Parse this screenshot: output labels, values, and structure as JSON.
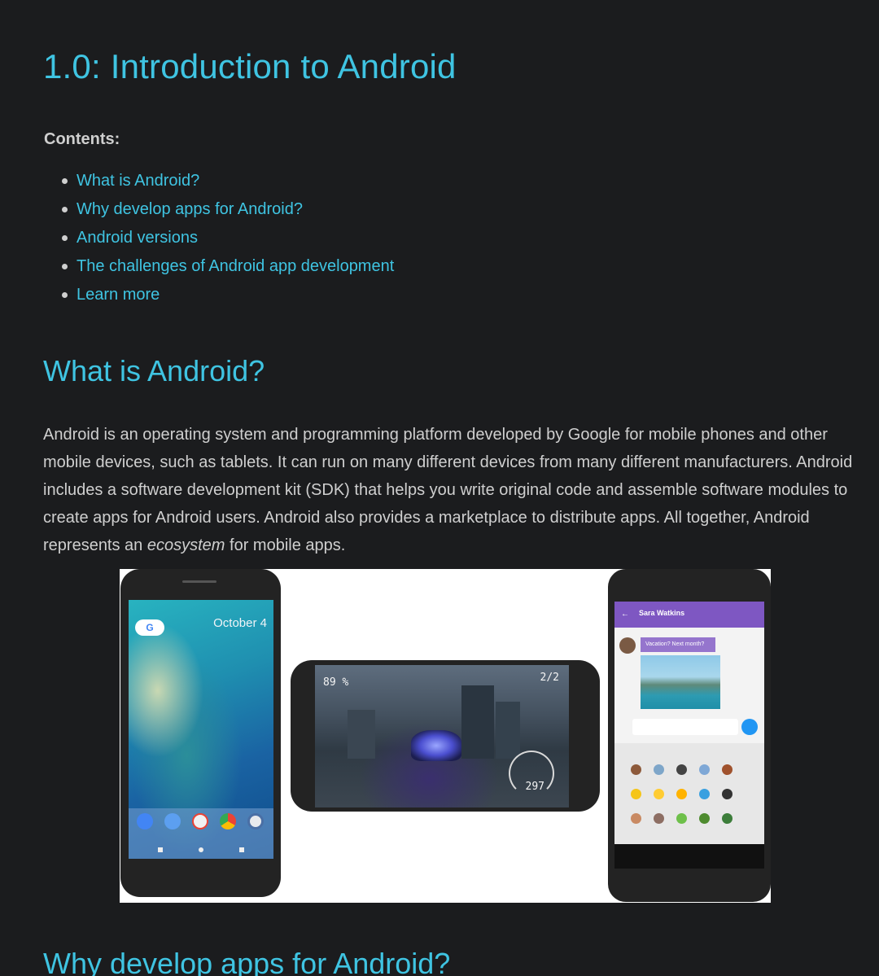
{
  "page": {
    "title": "1.0: Introduction to Android",
    "contents_label": "Contents:",
    "toc": [
      "What is Android?",
      "Why develop apps for Android?",
      "Android versions",
      "The challenges of Android app development",
      "Learn more"
    ]
  },
  "section_what": {
    "heading": "What is Android?",
    "para_before_em": "Android is an operating system and programming platform developed by Google for mobile phones and other mobile devices, such as tablets. It can run on many different devices from many different manufacturers. Android includes a software development kit (SDK) that helps you write original code and assemble software modules to create apps for Android users. Android also provides a marketplace to distribute apps. All together, Android represents an ",
    "para_em": "ecosystem",
    "para_after_em": " for mobile apps."
  },
  "figure": {
    "phone1": {
      "search_pill": "G",
      "date": "October 4"
    },
    "phone2": {
      "hud_left": "89 %",
      "hud_right": "2/2",
      "speed": "297"
    },
    "phone3": {
      "contact_name": "Sara Watkins",
      "message": "Vacation? Next month?"
    }
  },
  "section_why": {
    "heading": "Why develop apps for Android?"
  }
}
